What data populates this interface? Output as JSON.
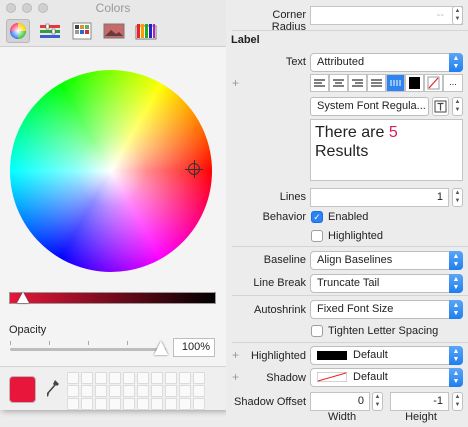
{
  "colors_panel": {
    "title": "Colors",
    "tabs": [
      "color-wheel",
      "color-sliders",
      "color-palettes",
      "image-palettes",
      "crayons"
    ],
    "opacity_label": "Opacity",
    "opacity_value": "100%",
    "current_color": "#e8163a"
  },
  "inspector": {
    "corner_radius_label": "Corner Radius",
    "corner_radius_placeholder": "--",
    "section_label": "Label",
    "text_label": "Text",
    "text_value": "Attributed",
    "font_value": "System Font Regula...",
    "text_content_prefix": "There are ",
    "text_content_number": "5",
    "text_content_suffix": "Results",
    "text_accent": "#d81b60",
    "lines_label": "Lines",
    "lines_value": "1",
    "behavior_label": "Behavior",
    "enabled_label": "Enabled",
    "highlighted_check_label": "Highlighted",
    "baseline_label": "Baseline",
    "baseline_value": "Align Baselines",
    "linebreak_label": "Line Break",
    "linebreak_value": "Truncate Tail",
    "autoshrink_label": "Autoshrink",
    "autoshrink_value": "Fixed Font Size",
    "tighten_label": "Tighten Letter Spacing",
    "highlighted_label": "Highlighted",
    "highlighted_value": "Default",
    "shadow_label": "Shadow",
    "shadow_value": "Default",
    "shadow_offset_label": "Shadow Offset",
    "shadow_offset_width": "0",
    "shadow_offset_height": "-1",
    "width_label": "Width",
    "height_label": "Height",
    "more_label": "..."
  }
}
